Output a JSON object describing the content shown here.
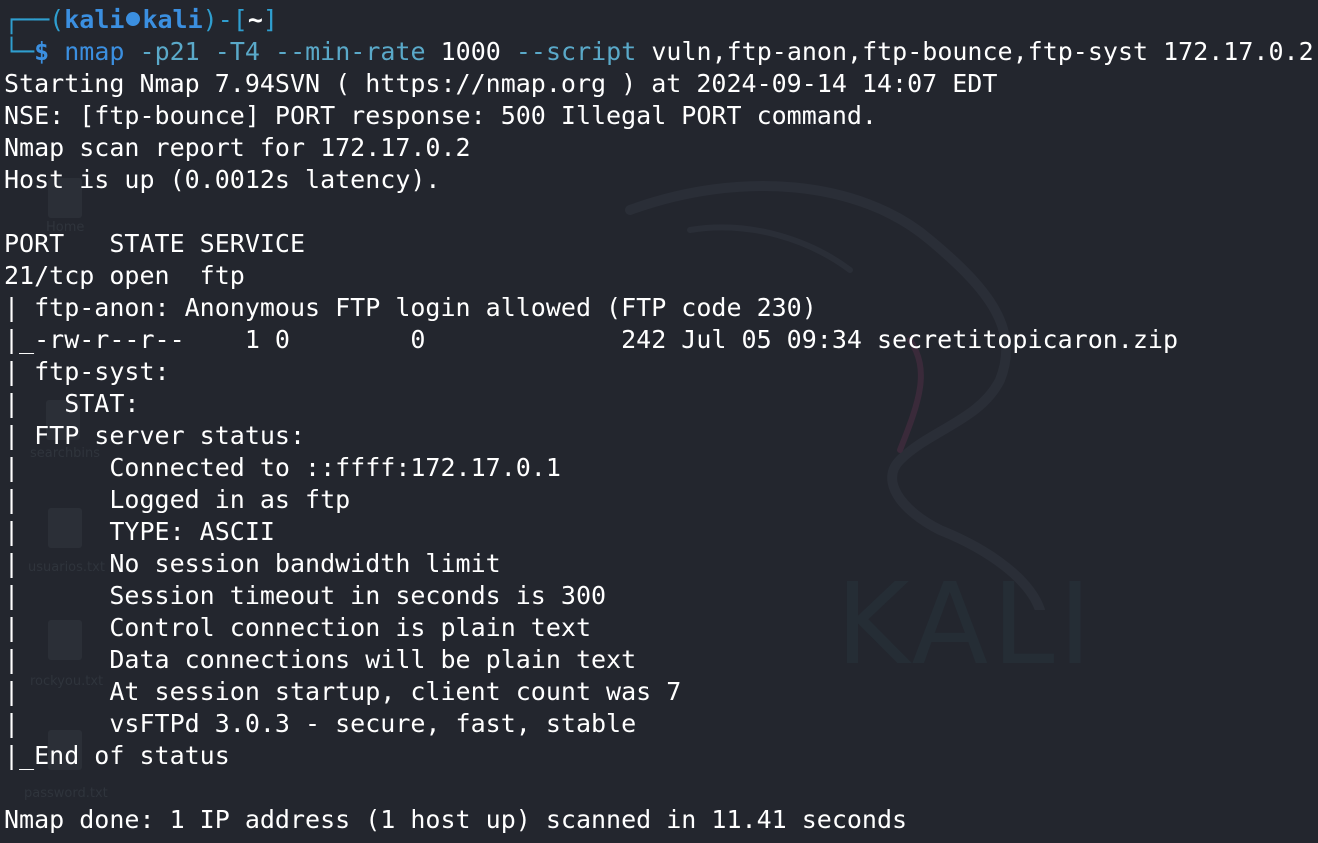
{
  "terminal": {
    "prompt": {
      "frame_top": "┌──(",
      "user": "kali",
      "host": "kali",
      "bracket_mid": ")-[",
      "dir": "~",
      "bracket_end": "]",
      "frame_bottom": "└─",
      "dollar": "$",
      "cmd_main": "nmap",
      "cmd_opt1": "-p21",
      "cmd_opt2": "-T4",
      "cmd_opt3": "--min-rate",
      "cmd_val3": "1000",
      "cmd_opt4": "--script",
      "cmd_val4": "vuln,ftp-anon,ftp-bounce,ftp-syst 172.17.0.2"
    },
    "output": [
      "Starting Nmap 7.94SVN ( https://nmap.org ) at 2024-09-14 14:07 EDT",
      "NSE: [ftp-bounce] PORT response: 500 Illegal PORT command.",
      "Nmap scan report for 172.17.0.2",
      "Host is up (0.0012s latency).",
      "",
      "PORT   STATE SERVICE",
      "21/tcp open  ftp",
      "| ftp-anon: Anonymous FTP login allowed (FTP code 230)",
      "|_-rw-r--r--    1 0        0             242 Jul 05 09:34 secretitopicaron.zip",
      "| ftp-syst:",
      "|   STAT:",
      "| FTP server status:",
      "|      Connected to ::ffff:172.17.0.1",
      "|      Logged in as ftp",
      "|      TYPE: ASCII",
      "|      No session bandwidth limit",
      "|      Session timeout in seconds is 300",
      "|      Control connection is plain text",
      "|      Data connections will be plain text",
      "|      At session startup, client count was 7",
      "|      vsFTPd 3.0.3 - secure, fast, stable",
      "|_End of status",
      "",
      "Nmap done: 1 IP address (1 host up) scanned in 11.41 seconds"
    ]
  },
  "background": {
    "watermark": "KALI",
    "desktop_files": [
      "Home",
      "searchbins",
      "usuarios.txt",
      "rockyou.txt",
      "password.txt"
    ]
  }
}
